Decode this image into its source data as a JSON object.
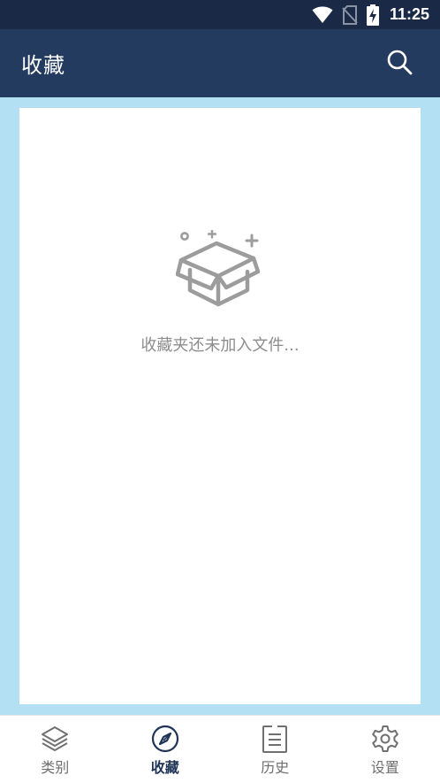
{
  "status_bar": {
    "time": "11:25",
    "icons": [
      "wifi-icon",
      "no-sim-icon",
      "battery-charging-icon"
    ]
  },
  "app_bar": {
    "title": "收藏",
    "search_icon": "search-icon"
  },
  "colors": {
    "status_bar_bg": "#1a2a46",
    "app_bar_bg": "#243b60",
    "content_bg": "#b3e0f3",
    "active_tab": "#1f3456",
    "inactive_tab": "#6e6e6e"
  },
  "empty_state": {
    "icon": "open-box-icon",
    "message": "收藏夹还未加入文件..."
  },
  "bottom_nav": {
    "items": [
      {
        "label": "类别",
        "icon": "layers-icon",
        "active": false
      },
      {
        "label": "收藏",
        "icon": "compass-icon",
        "active": true
      },
      {
        "label": "历史",
        "icon": "history-list-icon",
        "active": false
      },
      {
        "label": "设置",
        "icon": "gear-icon",
        "active": false
      }
    ]
  }
}
